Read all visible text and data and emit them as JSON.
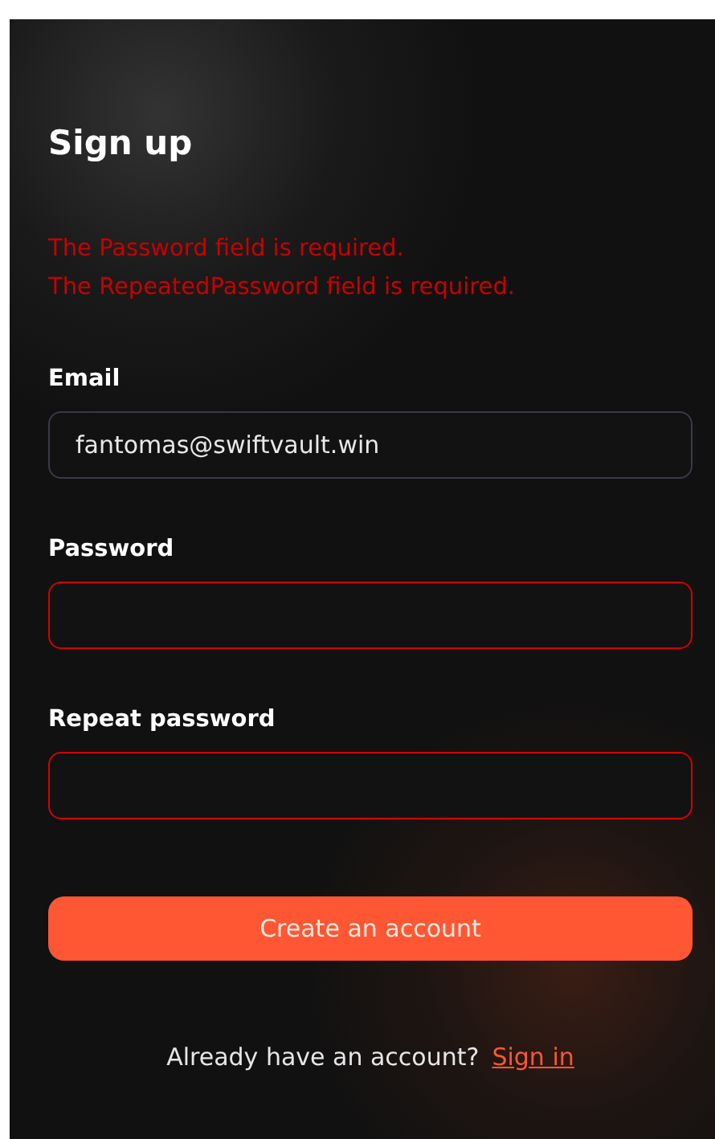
{
  "title": "Sign up",
  "errors": [
    "The Password field is required.",
    "The RepeatedPassword field is required."
  ],
  "fields": [
    {
      "label": "Email",
      "value": "fantomas@swiftvault.win",
      "invalid": false
    },
    {
      "label": "Password",
      "invalid": true
    },
    {
      "label": "Repeat password",
      "invalid": true
    }
  ],
  "submit": "Create an account",
  "footer": {
    "text": "Already have an account?",
    "link": "Sign in"
  }
}
